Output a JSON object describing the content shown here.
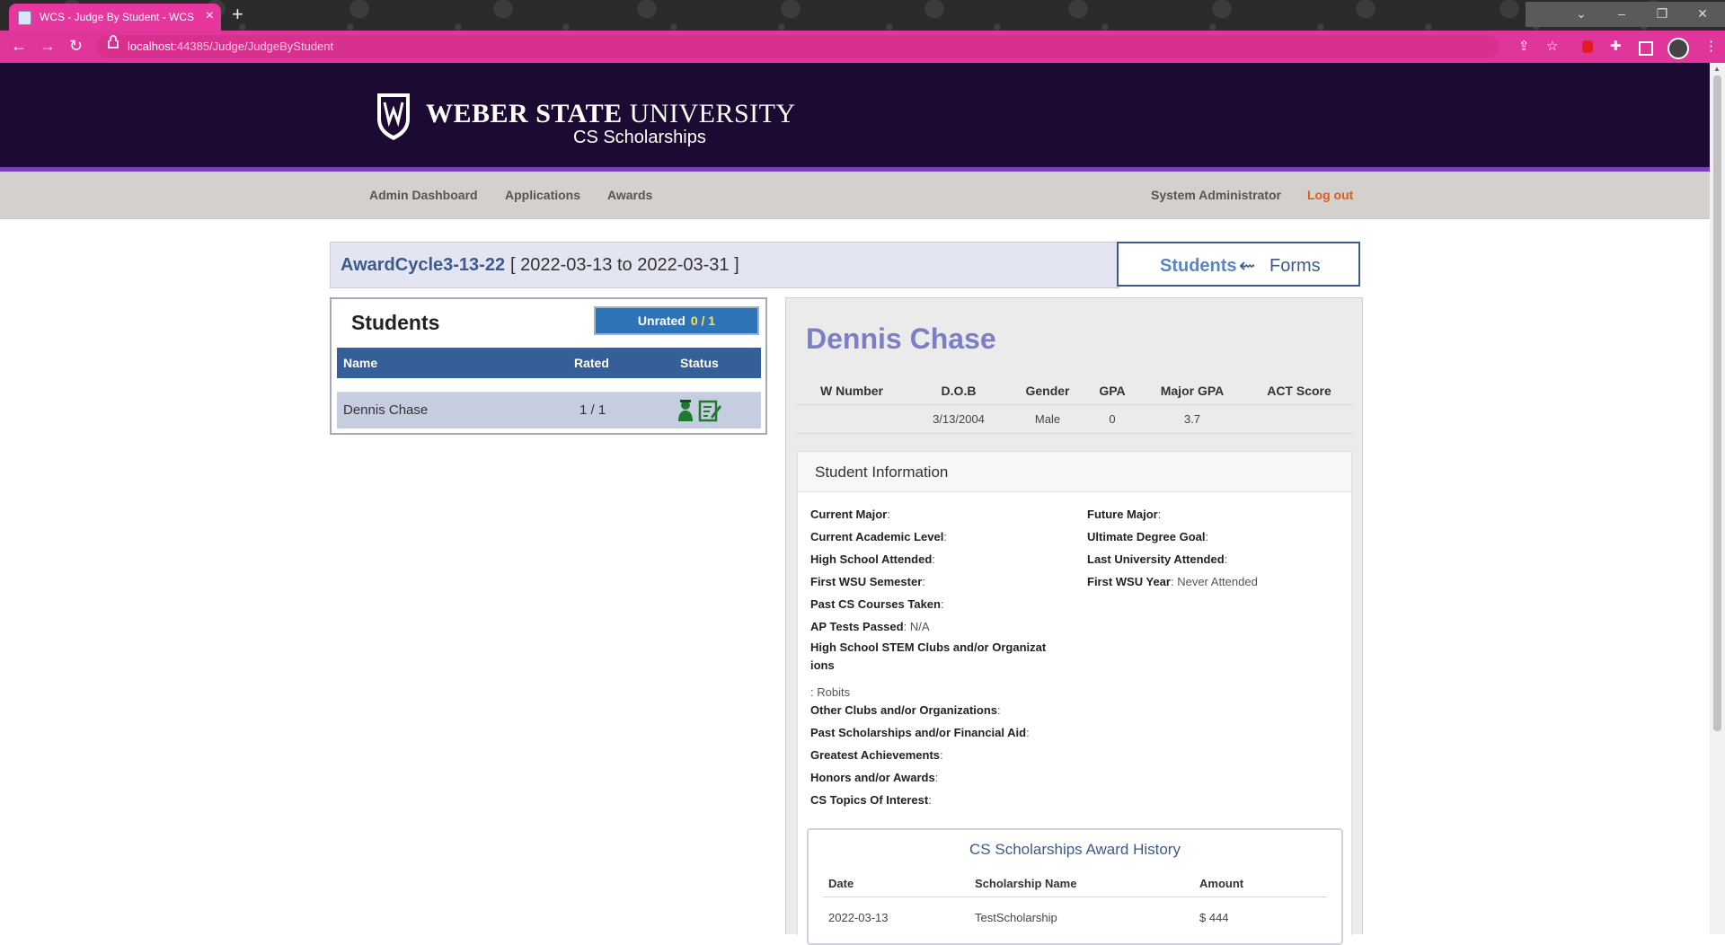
{
  "browser": {
    "tab_title": "WCS - Judge By Student - WCS",
    "tab_close": "×",
    "new_tab": "+",
    "url_host": "localhost",
    "url_path": ":44385/Judge/JudgeByStudent",
    "back": "←",
    "forward": "→",
    "reload": "↻",
    "win_menu": "⌄",
    "win_min": "–",
    "win_restore": "❐",
    "win_close": "✕",
    "icons": [
      "share-icon",
      "bookmark-star-icon",
      "extension-red-icon",
      "puzzle-extensions-icon",
      "side-panel-icon",
      "profile-avatar-icon",
      "more-menu-icon"
    ],
    "theme_color": "#e0369c"
  },
  "header": {
    "brand_bold": "WEBER STATE",
    "brand_light": " UNIVERSITY",
    "subtitle": "CS Scholarships",
    "bg_color": "#1c0a33",
    "accent_color": "#7a3fbf"
  },
  "nav": {
    "admin_dashboard": "Admin Dashboard",
    "applications": "Applications",
    "awards": "Awards",
    "user": "System Administrator",
    "logout": "Log out"
  },
  "cycle": {
    "name": "AwardCycle3-13-22",
    "dates": "[ 2022-03-13 to 2022-03-31 ]",
    "switch_students": "Students",
    "switch_arrow": "⇜",
    "switch_forms": "Forms"
  },
  "students_panel": {
    "title": "Students",
    "unrated_label": "Unrated",
    "unrated_count": "0 / 1",
    "columns": [
      "Name",
      "Rated",
      "Status"
    ],
    "rows": [
      {
        "name": "Dennis Chase",
        "rated": "1 / 1",
        "status_icons": [
          "student-icon",
          "form-edit-icon"
        ]
      }
    ]
  },
  "student": {
    "name": "Dennis Chase",
    "columns": [
      "W Number",
      "D.O.B",
      "Gender",
      "GPA",
      "Major GPA",
      "ACT Score"
    ],
    "values": [
      "",
      "3/13/2004",
      "Male",
      "0",
      "3.7",
      ""
    ],
    "info_title": "Student Information",
    "left_fields": [
      {
        "label": "Current Major",
        "value": ""
      },
      {
        "label": "Current Academic Level",
        "value": ""
      },
      {
        "label": "High School Attended",
        "value": ""
      },
      {
        "label": "First WSU Semester",
        "value": ""
      },
      {
        "label": "Past CS Courses Taken",
        "value": ""
      },
      {
        "label": "AP Tests Passed",
        "value": "N/A"
      }
    ],
    "stem_label_1": "High School STEM Clubs and/or Organizat",
    "stem_label_2": "ions",
    "stem_value": ": Robits",
    "left_fields_2": [
      {
        "label": "Other Clubs and/or Organizations",
        "value": ""
      },
      {
        "label": "Past Scholarships and/or Financial Aid",
        "value": ""
      },
      {
        "label": "Greatest Achievements",
        "value": ""
      },
      {
        "label": "Honors and/or Awards",
        "value": ""
      },
      {
        "label": "CS Topics Of Interest",
        "value": ""
      }
    ],
    "right_fields": [
      {
        "label": "Future Major",
        "value": ""
      },
      {
        "label": "Ultimate Degree Goal",
        "value": ""
      },
      {
        "label": "Last University Attended",
        "value": ""
      },
      {
        "label": "First WSU Year",
        "value": "Never Attended"
      }
    ]
  },
  "award_history": {
    "title": "CS Scholarships Award History",
    "columns": [
      "Date",
      "Scholarship Name",
      "Amount"
    ],
    "rows": [
      {
        "date": "2022-03-13",
        "name": "TestScholarship",
        "amount": "$ 444"
      }
    ]
  }
}
